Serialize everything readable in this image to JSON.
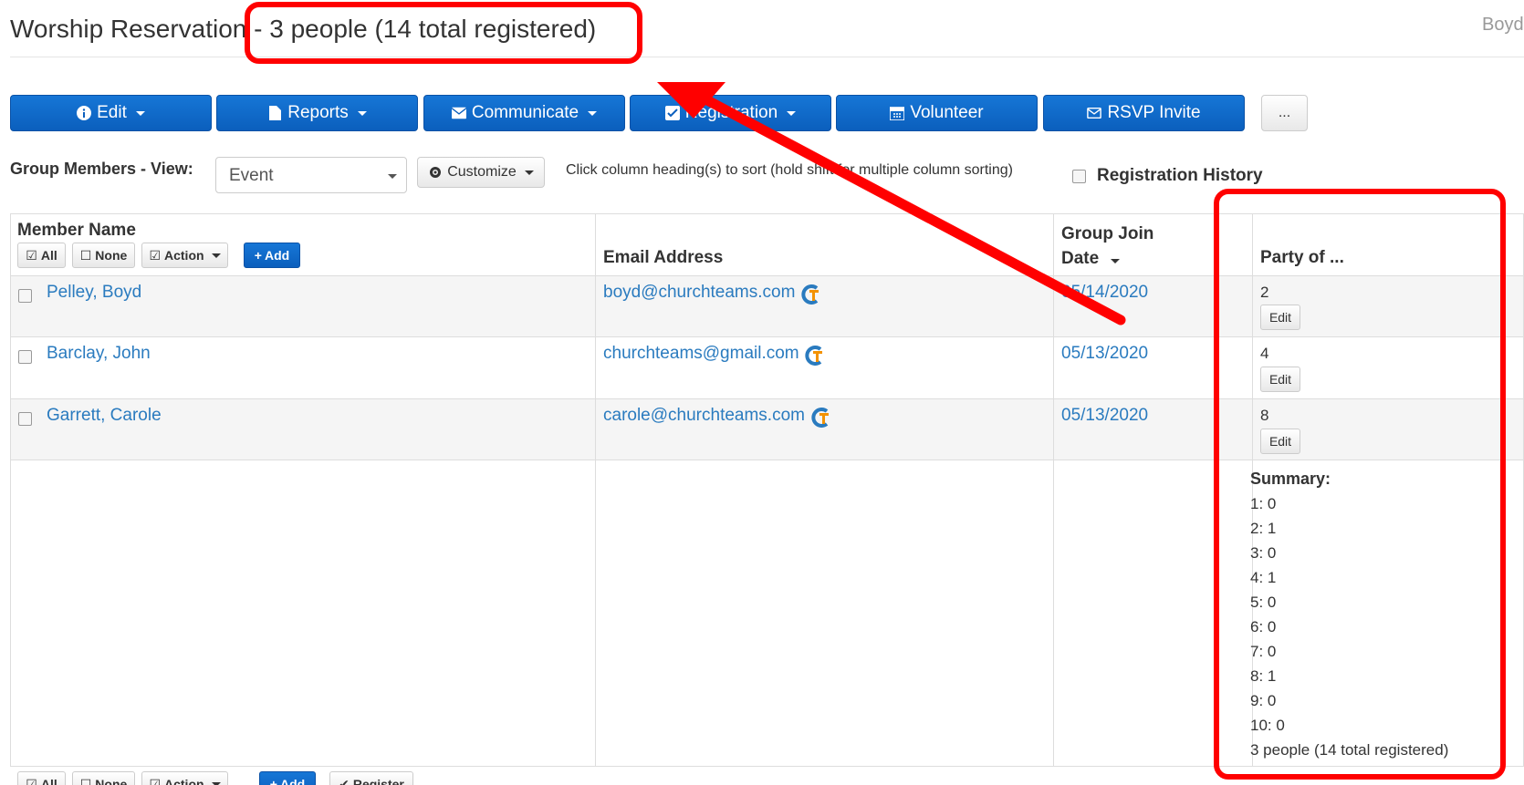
{
  "header": {
    "title": "Worship Reservation - 3 people (14 total registered)",
    "user": "Boyd"
  },
  "toolbar": {
    "edit": "Edit",
    "reports": "Reports",
    "communicate": "Communicate",
    "registration": "Registration",
    "volunteer": "Volunteer",
    "rsvp": "RSVP Invite",
    "more": "..."
  },
  "view": {
    "label": "Group Members - View:",
    "selected": "Event",
    "customize": "Customize",
    "sort_hint": "Click column heading(s) to sort (hold shift for multiple column sorting)",
    "registration_history": "Registration History"
  },
  "table": {
    "headers": {
      "member_name": "Member Name",
      "email": "Email Address",
      "join_date_line1": "Group Join",
      "join_date_line2": "Date",
      "party": "Party of ..."
    },
    "bulk": {
      "all": "All",
      "none": "None",
      "action": "Action",
      "add": "Add",
      "register": "Register"
    },
    "rows": [
      {
        "name": "Pelley, Boyd",
        "email": "boyd@churchteams.com",
        "date": "05/14/2020",
        "party": "2",
        "edit": "Edit"
      },
      {
        "name": "Barclay, John",
        "email": "churchteams@gmail.com",
        "date": "05/13/2020",
        "party": "4",
        "edit": "Edit"
      },
      {
        "name": "Garrett, Carole",
        "email": "carole@churchteams.com",
        "date": "05/13/2020",
        "party": "8",
        "edit": "Edit"
      }
    ],
    "summary": {
      "head": "Summary:",
      "lines": [
        "1: 0",
        "2: 1",
        "3: 0",
        "4: 1",
        "5: 0",
        "6: 0",
        "7: 0",
        "8: 1",
        "9: 0",
        "10: 0"
      ],
      "total": "3 people (14 total registered)"
    }
  },
  "colors": {
    "primary": "#0b5fbd",
    "link": "#2a7bbf",
    "annotation": "#ff0000"
  }
}
